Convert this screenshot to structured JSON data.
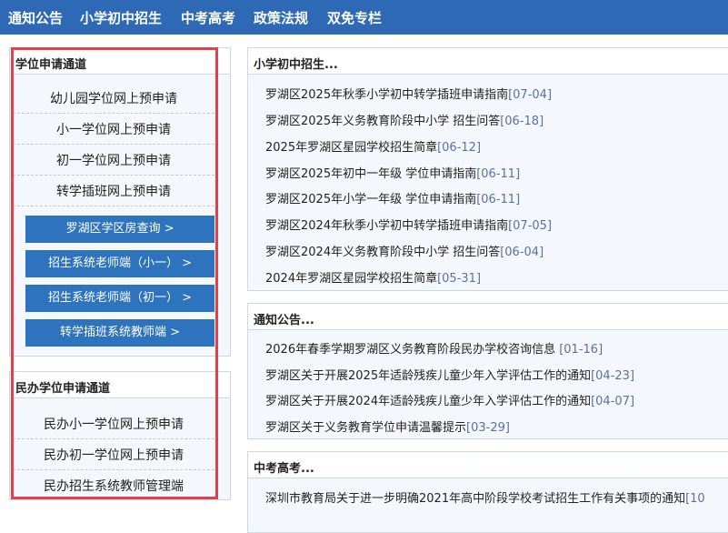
{
  "nav": [
    "通知公告",
    "小学初中招生",
    "中考高考",
    "政策法规",
    "双免专栏"
  ],
  "left": {
    "section1_title": "学位申请通道",
    "apply_items": [
      "幼儿园学位网上预申请",
      "小一学位网上预申请",
      "初一学位网上预申请",
      "转学插班网上预申请"
    ],
    "buttons": [
      "罗湖区学区房查询 >",
      "招生系统老师端（小一） >",
      "招生系统老师端（初一） >",
      "转学插班系统教师端 >"
    ],
    "section2_title": "民办学位申请通道",
    "private_items": [
      "民办小一学位网上预申请",
      "民办初一学位网上预申请",
      "民办招生系统教师管理端"
    ]
  },
  "main": {
    "sec1_title": "小学初中招生...",
    "sec1_items": [
      {
        "title": "罗湖区2025年秋季小学初中转学插班申请指南",
        "date": "[07-04]"
      },
      {
        "title": "罗湖区2025年义务教育阶段中小学 招生问答",
        "date": "[06-18]"
      },
      {
        "title": "2025年罗湖区星园学校招生简章",
        "date": "[06-12]"
      },
      {
        "title": "罗湖区2025年初中一年级 学位申请指南",
        "date": "[06-11]"
      },
      {
        "title": "罗湖区2025年小学一年级 学位申请指南",
        "date": "[06-11]"
      },
      {
        "title": "罗湖区2024年秋季小学初中转学插班申请指南",
        "date": "[07-05]"
      },
      {
        "title": "罗湖区2024年义务教育阶段中小学 招生问答",
        "date": "[06-04]"
      },
      {
        "title": "2024年罗湖区星园学校招生简章",
        "date": "[05-31]"
      }
    ],
    "sec2_title": "通知公告...",
    "sec2_items": [
      {
        "title": "2026年春季学期罗湖区义务教育阶段民办学校咨询信息 ",
        "date": "[01-16]"
      },
      {
        "title": "罗湖区关于开展2025年适龄残疾儿童少年入学评估工作的通知",
        "date": "[04-23]"
      },
      {
        "title": "罗湖区关于开展2024年适龄残疾儿童少年入学评估工作的通知",
        "date": "[04-07]"
      },
      {
        "title": "罗湖区关于义务教育学位申请温馨提示",
        "date": "[03-29]"
      }
    ],
    "sec3_title": "中考高考...",
    "sec3_items": [
      {
        "title": "深圳市教育局关于进一步明确2021年高中阶段学校考试招生工作有关事项的通知",
        "date": "[10"
      }
    ]
  }
}
